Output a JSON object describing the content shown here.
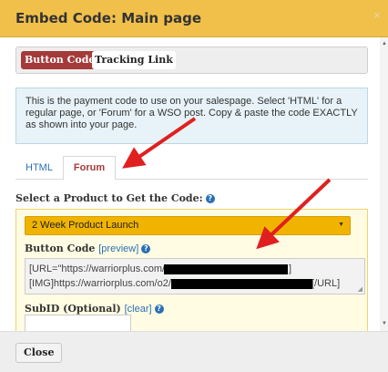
{
  "modal": {
    "title": "Embed Code: Main page",
    "close_glyph": "×"
  },
  "top_tabs": {
    "active_label": "Button Code",
    "other_label": "Tracking Link"
  },
  "info": {
    "text": "This is the payment code to use on your salespage. Select 'HTML' for a regular page, or 'Forum' for a WSO post. Copy & paste the code EXACTLY as shown into your page."
  },
  "format_tabs": {
    "html_label": "HTML",
    "forum_label": "Forum"
  },
  "product": {
    "label": "Select a Product to Get the Code:",
    "selected": "2 Week Product Launch"
  },
  "button_code": {
    "label": "Button Code",
    "preview_link": "[preview]",
    "line1_start": "[URL=\"https://warriorplus.com/",
    "line1_end": "]",
    "line2_start": "[IMG]https://warriorplus.com/o2/",
    "line2_end": "[/URL]"
  },
  "subid": {
    "label": "SubID (Optional)",
    "clear_link": "[clear]",
    "value": ""
  },
  "footer": {
    "close_label": "Close"
  },
  "colors": {
    "header_bg": "#f0c04a",
    "active_tab": "#a43a3a",
    "select_bg": "#f0b400",
    "arrow": "#e02020",
    "link": "#2a6fb5"
  },
  "icons": [
    "close-icon",
    "help-icon",
    "chevron-down-icon",
    "arrow-annotation"
  ]
}
